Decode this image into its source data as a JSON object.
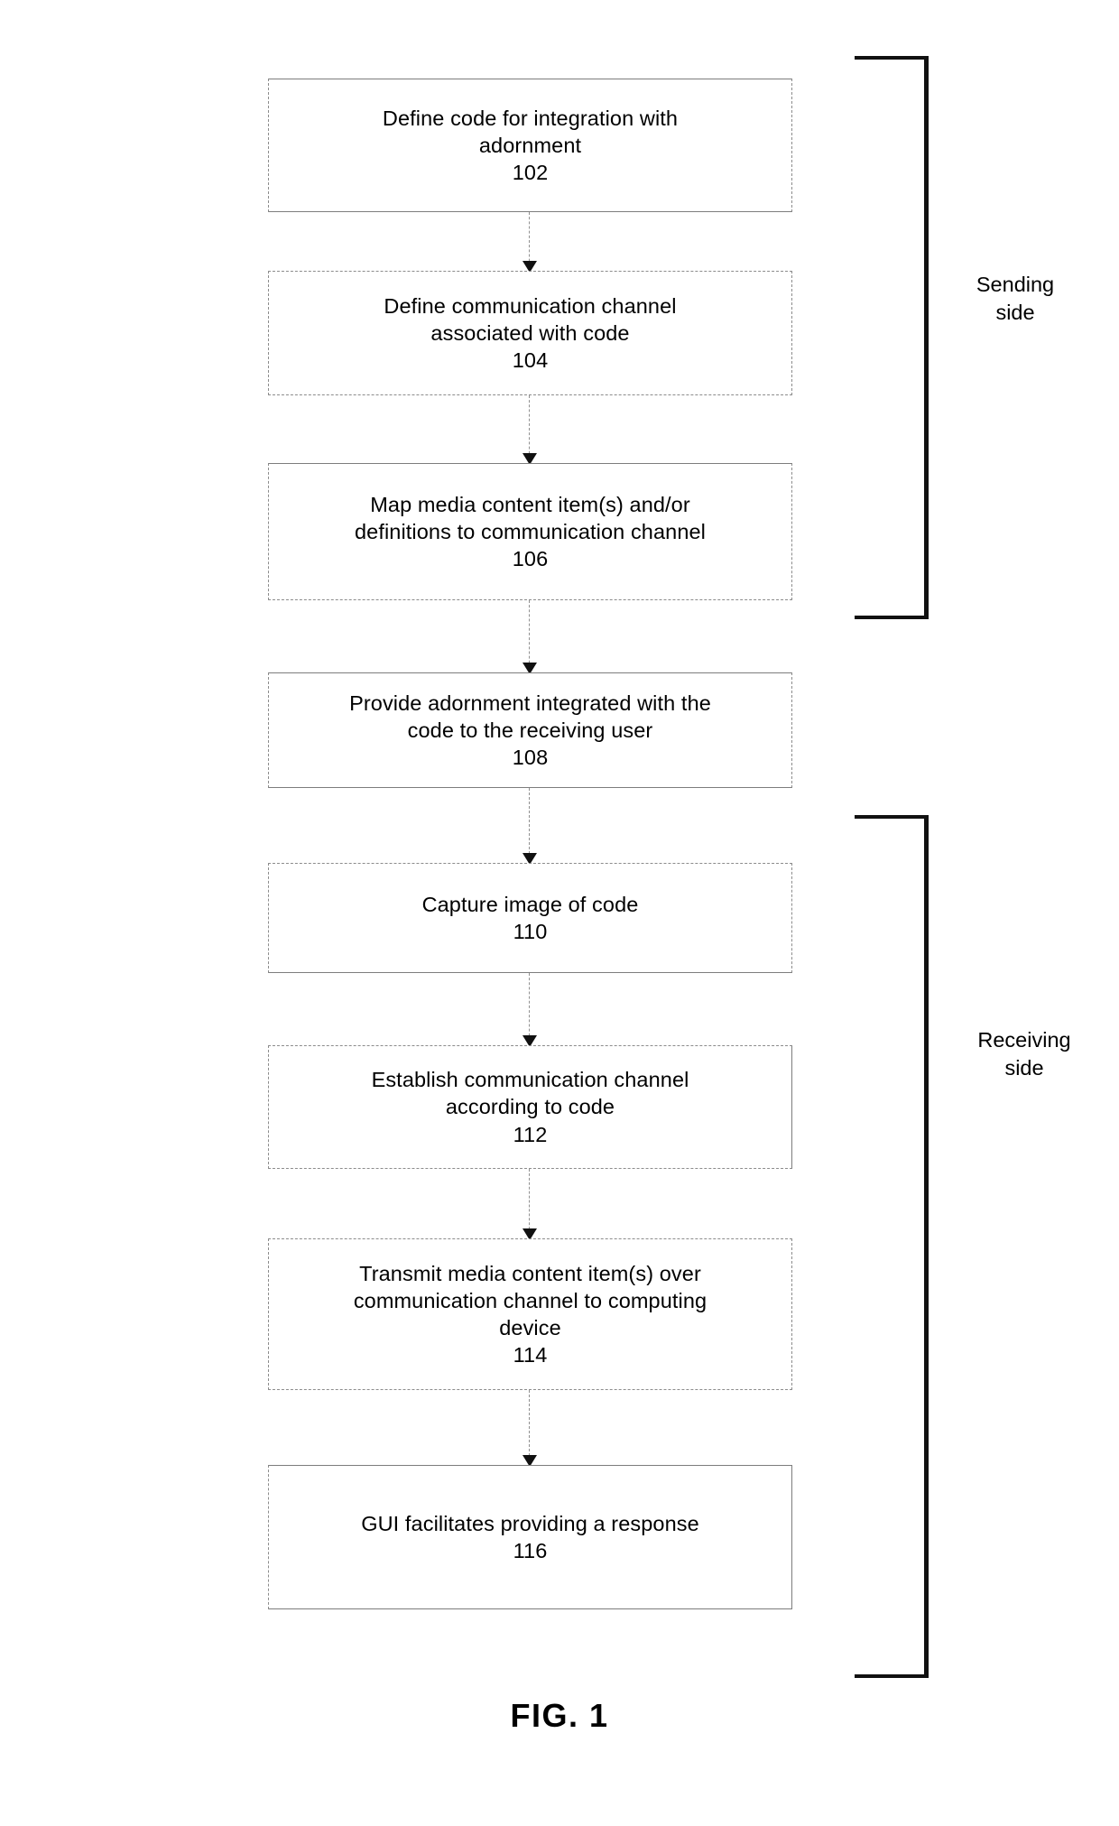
{
  "figure": {
    "caption": "FIG. 1",
    "boxes": [
      {
        "id": "102",
        "lines": [
          "Define code for integration with",
          "adornment"
        ],
        "number": "102"
      },
      {
        "id": "104",
        "lines": [
          "Define communication channel",
          "associated with code"
        ],
        "number": "104"
      },
      {
        "id": "106",
        "lines": [
          "Map media content item(s) and/or",
          "definitions to communication channel"
        ],
        "number": "106"
      },
      {
        "id": "108",
        "lines": [
          "Provide adornment integrated with the",
          "code to the receiving user"
        ],
        "number": "108"
      },
      {
        "id": "110",
        "lines": [
          "Capture image of code"
        ],
        "number": "110"
      },
      {
        "id": "112",
        "lines": [
          "Establish communication channel",
          "according to code"
        ],
        "number": "112"
      },
      {
        "id": "114",
        "lines": [
          "Transmit media content item(s) over",
          "communication channel to computing",
          "device"
        ],
        "number": "114"
      },
      {
        "id": "116",
        "lines": [
          "GUI facilitates providing a response"
        ],
        "number": "116"
      }
    ],
    "brackets": [
      {
        "id": "sending",
        "label_lines": [
          "Sending",
          "side"
        ]
      },
      {
        "id": "receiving",
        "label_lines": [
          "Receiving",
          "side"
        ]
      }
    ],
    "colors": {
      "box_border_solid": "#7d7d7d",
      "box_border_dashed": "#8c8c8c",
      "connector": "#909090",
      "arrowhead": "#111111",
      "bracket": "#111111",
      "text": "#000000",
      "background": "#ffffff"
    }
  }
}
